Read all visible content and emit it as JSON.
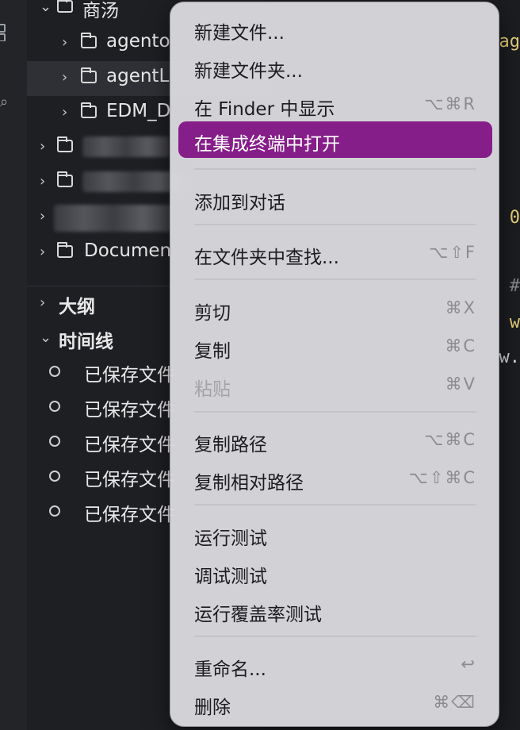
{
  "explorer": {
    "items": [
      {
        "label": "商汤",
        "expanded": true
      },
      {
        "label": "agento"
      },
      {
        "label": "agentL",
        "selected": true
      },
      {
        "label": "EDM_D"
      },
      {
        "label": ""
      },
      {
        "label": ""
      },
      {
        "label": ""
      },
      {
        "label": "Documen"
      }
    ]
  },
  "outline": {
    "label": "大纲"
  },
  "timeline": {
    "label": "时间线",
    "entries": [
      "已保存文件",
      "已保存文件",
      "已保存文件",
      "已保存文件",
      "已保存文件"
    ]
  },
  "editor": {
    "fragments": [
      "ag",
      "0",
      "#",
      "w",
      "w."
    ]
  },
  "context_menu": {
    "groups": [
      [
        {
          "label": "新建文件...",
          "shortcut": ""
        },
        {
          "label": "新建文件夹...",
          "shortcut": ""
        },
        {
          "label": "在 Finder 中显示",
          "shortcut": "⌥⌘R"
        },
        {
          "label": "在集成终端中打开",
          "shortcut": "",
          "highlighted": true
        }
      ],
      [
        {
          "label": "添加到对话",
          "shortcut": ""
        }
      ],
      [
        {
          "label": "在文件夹中查找...",
          "shortcut": "⌥⇧F"
        }
      ],
      [
        {
          "label": "剪切",
          "shortcut": "⌘X"
        },
        {
          "label": "复制",
          "shortcut": "⌘C"
        },
        {
          "label": "粘贴",
          "shortcut": "⌘V",
          "disabled": true
        }
      ],
      [
        {
          "label": "复制路径",
          "shortcut": "⌥⌘C"
        },
        {
          "label": "复制相对路径",
          "shortcut": "⌥⇧⌘C"
        }
      ],
      [
        {
          "label": "运行测试",
          "shortcut": ""
        },
        {
          "label": "调试测试",
          "shortcut": ""
        },
        {
          "label": "运行覆盖率测试",
          "shortcut": ""
        }
      ],
      [
        {
          "label": "重命名...",
          "shortcut": "↩"
        },
        {
          "label": "删除",
          "shortcut": "⌘⌫"
        }
      ]
    ],
    "highlight_color": "#861e8a"
  }
}
